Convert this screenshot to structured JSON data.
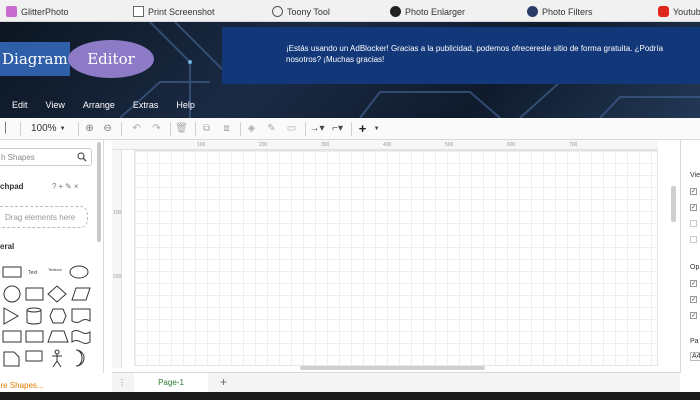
{
  "bookmarks": [
    {
      "label": "GlitterPhoto",
      "icon": "glitter-icon"
    },
    {
      "label": "Print Screenshot",
      "icon": "print-icon"
    },
    {
      "label": "Toony Tool",
      "icon": "toony-icon"
    },
    {
      "label": "Photo Enlarger",
      "icon": "enlarger-icon"
    },
    {
      "label": "Photo Filters",
      "icon": "filters-icon"
    },
    {
      "label": "Youtub",
      "icon": "youtube-icon"
    }
  ],
  "logo": {
    "part1": "Diagram",
    "part2": "Editor"
  },
  "adblock_notice": "¡Estás usando un AdBlocker! Gracias a la publicidad, podemos ofreceresle sitio de forma gratuita. ¿Podría nosotros? ¡Muchas gracias!",
  "menu": [
    "Edit",
    "View",
    "Arrange",
    "Extras",
    "Help"
  ],
  "toolbar": {
    "zoom": "100%",
    "zoom_icon": "chevron-down-icon"
  },
  "sidebar": {
    "search_placeholder": "h Shapes",
    "scratchpad_label": "chpad",
    "scratchpad_icons": "?+✎×",
    "drop_hint": "Drag elements here",
    "general_label": "eral",
    "more_shapes": "ore Shapes...",
    "shape_labels": [
      "Text",
      "Textbox"
    ]
  },
  "ruler": {
    "top": [
      "100",
      "200",
      "300",
      "400",
      "500",
      "600",
      "700"
    ],
    "left": [
      "100",
      "200"
    ]
  },
  "rightpanel": {
    "view_label": "Vie",
    "options_label": "Op",
    "paper_label": "Pa",
    "paper_value": "A4"
  },
  "pages": {
    "tab": "Page-1",
    "add": "+",
    "menu": "⋮"
  },
  "colors": {
    "banner": "#1b2b45",
    "logo_blue": "#2f5fa8",
    "logo_purple": "#8e7bc7",
    "ad_bg": "#12387a",
    "page_tab_text": "#2f7a2f",
    "more_shapes": "#e07b00"
  }
}
